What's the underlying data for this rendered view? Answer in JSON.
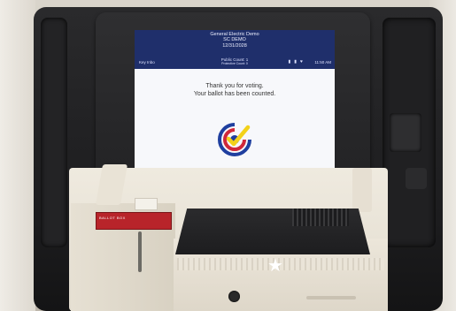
{
  "screen": {
    "header": {
      "line1": "General Electric Demo",
      "line2": "SC DEMO",
      "line3": "12/31/2028"
    },
    "status": {
      "left": "Key Inbo",
      "center_line1": "Public Count: 1",
      "center_line2": "Protective Count: 0",
      "icons": [
        "usb-icon",
        "battery-icon",
        "wifi-icon"
      ],
      "time": "11:50 AM"
    },
    "message": {
      "line1": "Thank you for voting.",
      "line2": "Your ballot has been counted."
    },
    "logo": {
      "colors": {
        "blue": "#1f3f9f",
        "red": "#d0283a",
        "yellow": "#f3d21a"
      }
    }
  },
  "machine": {
    "label": "BALLOT BOX"
  },
  "colors": {
    "header_bg": "#1f2f6b",
    "screen_bg": "#f7f8fb",
    "base": "#e8e2d5",
    "case": "#1e1e20",
    "label_red": "#b8242a"
  }
}
